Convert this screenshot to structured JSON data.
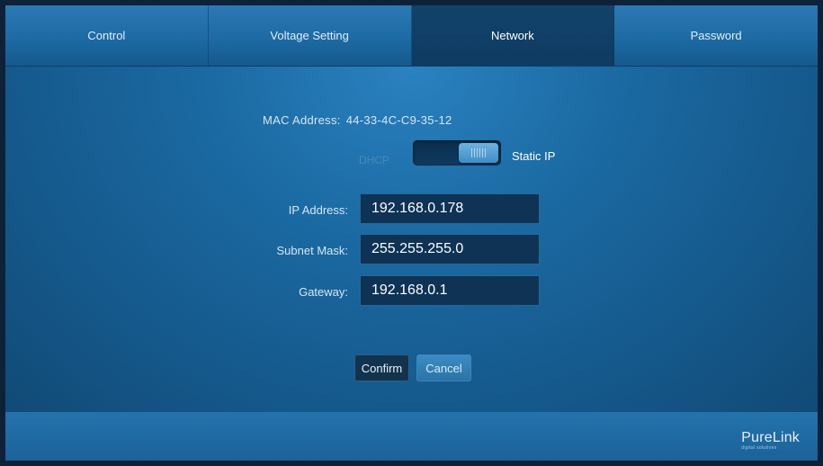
{
  "tabs": [
    {
      "label": "Control",
      "active": false
    },
    {
      "label": "Voltage Setting",
      "active": false
    },
    {
      "label": "Network",
      "active": true
    },
    {
      "label": "Password",
      "active": false
    }
  ],
  "network": {
    "mac_label": "MAC Address:",
    "mac_value": "44-33-4C-C9-35-12",
    "mode_left_label": "DHCP",
    "mode_right_label": "Static IP",
    "mode_selected": "Static IP",
    "ip_label": "IP Address:",
    "ip_value": "192.168.0.178",
    "subnet_label": "Subnet Mask:",
    "subnet_value": "255.255.255.0",
    "gateway_label": "Gateway:",
    "gateway_value": "192.168.0.1"
  },
  "buttons": {
    "confirm_label": "Confirm",
    "cancel_label": "Cancel"
  },
  "brand": {
    "name": "PureLink",
    "tagline": "digital solutions"
  },
  "colors": {
    "accent": "#1d6aa4",
    "active_tab": "#0e3b62"
  }
}
